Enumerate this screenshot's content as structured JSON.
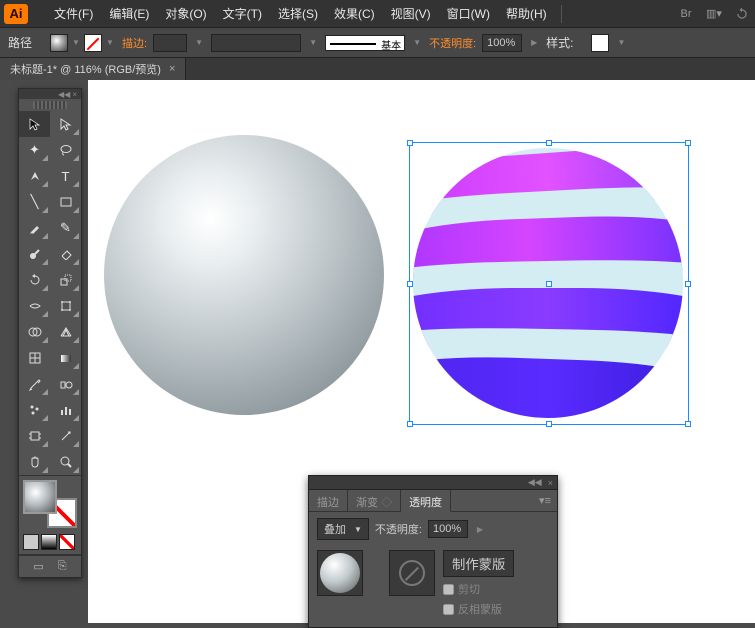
{
  "app_logo": "Ai",
  "menu": {
    "file": "文件(F)",
    "edit": "编辑(E)",
    "object": "对象(O)",
    "type": "文字(T)",
    "select": "选择(S)",
    "effect": "效果(C)",
    "view": "视图(V)",
    "window": "窗口(W)",
    "help": "帮助(H)"
  },
  "control": {
    "path_label": "路径",
    "stroke_label": "描边:",
    "stroke_weight": "",
    "stroke_basic_label": "基本",
    "opacity_label": "不透明度:",
    "opacity_value": "100%",
    "style_label": "样式:"
  },
  "doc_tab": {
    "title": "未标题-1* @ 116% (RGB/预览)"
  },
  "transparency_panel": {
    "tab_stroke": "描边",
    "tab_gradient": "渐变",
    "tab_transparency": "透明度",
    "blend_mode": "叠加",
    "opacity_label": "不透明度:",
    "opacity_value": "100%",
    "make_mask": "制作蒙版",
    "clip": "剪切",
    "invert_mask": "反相蒙版"
  }
}
